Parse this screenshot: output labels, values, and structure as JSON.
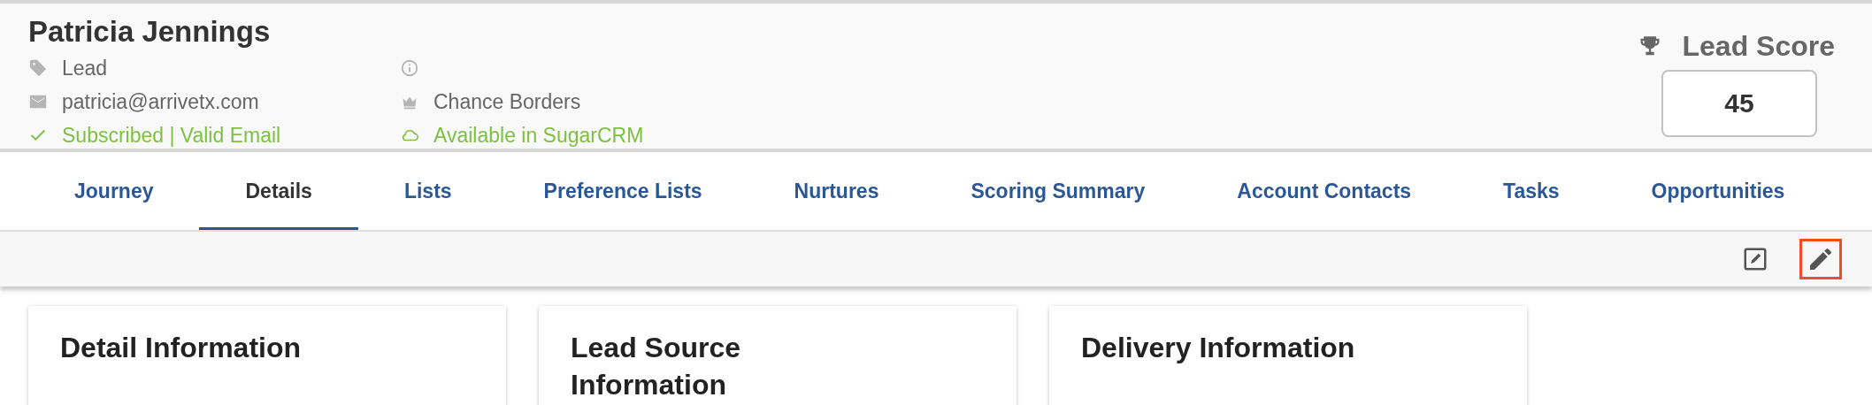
{
  "contact": {
    "name": "Patricia Jennings",
    "left_rows": [
      {
        "kind": "tag",
        "text": "Lead"
      },
      {
        "kind": "email",
        "text": "patricia@arrivetx.com"
      },
      {
        "kind": "check",
        "text": "Subscribed | Valid Email"
      }
    ],
    "right_rows": [
      {
        "kind": "info"
      },
      {
        "kind": "crown",
        "text": "Chance Borders"
      },
      {
        "kind": "cloud",
        "text": "Available in SugarCRM"
      }
    ]
  },
  "lead_score": {
    "label": "Lead Score",
    "value": "45"
  },
  "tabs": [
    {
      "label": "Journey",
      "selected": false
    },
    {
      "label": "Details",
      "selected": true
    },
    {
      "label": "Lists",
      "selected": false
    },
    {
      "label": "Preference Lists",
      "selected": false
    },
    {
      "label": "Nurtures",
      "selected": false
    },
    {
      "label": "Scoring Summary",
      "selected": false
    },
    {
      "label": "Account Contacts",
      "selected": false
    },
    {
      "label": "Tasks",
      "selected": false
    },
    {
      "label": "Opportunities",
      "selected": false
    }
  ],
  "toolbar": [
    {
      "kind": "edit-square",
      "highlighted": false
    },
    {
      "kind": "pencil",
      "highlighted": true
    }
  ],
  "cards": [
    {
      "title": "Detail Information"
    },
    {
      "title": "Lead Source Information"
    },
    {
      "title": "Delivery Information"
    }
  ]
}
